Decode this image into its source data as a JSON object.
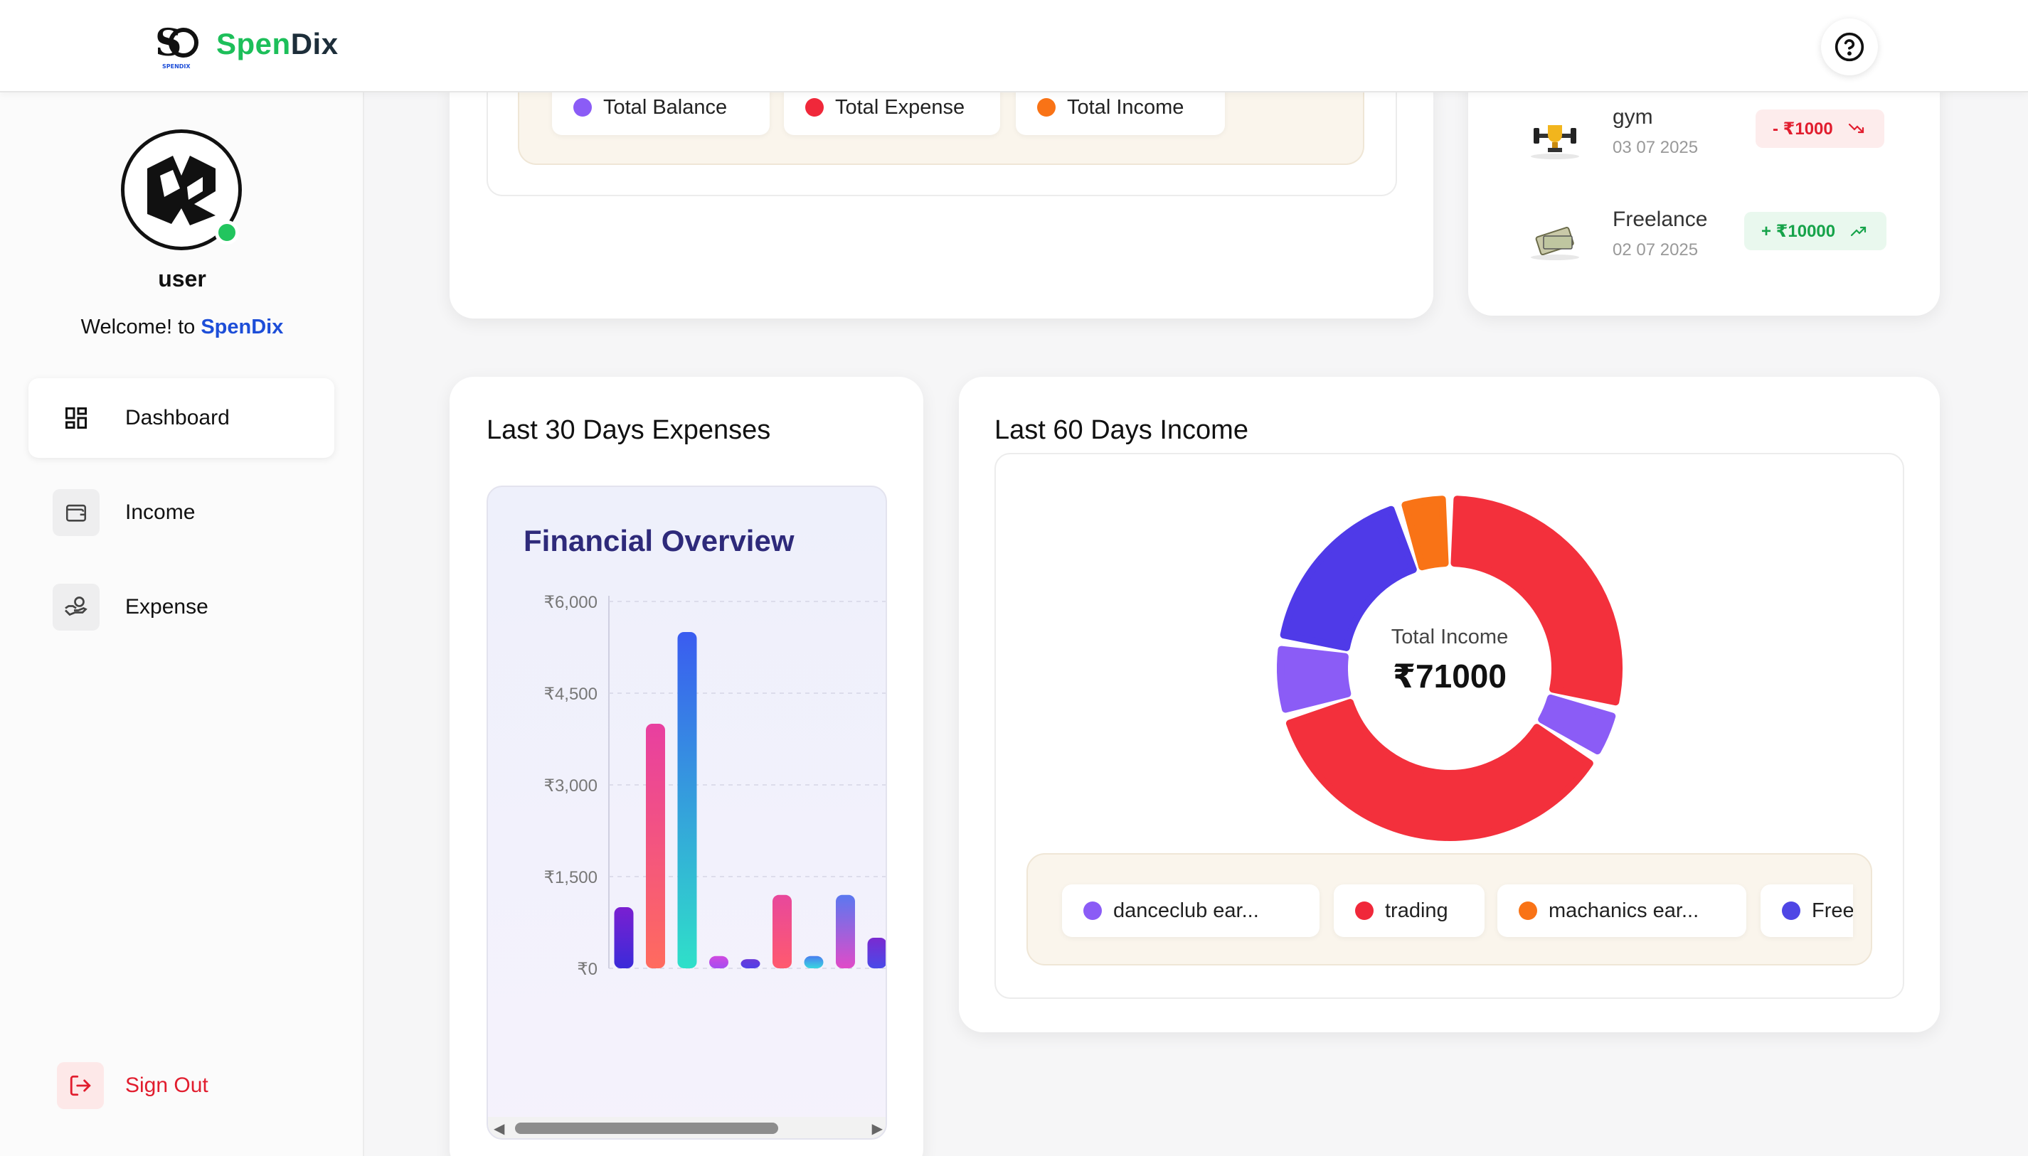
{
  "app": {
    "name_part1": "Spen",
    "name_part2": "Dix",
    "logo_caption": "SPENDIX"
  },
  "header": {
    "help_icon": "question-circle-icon"
  },
  "sidebar": {
    "username": "user",
    "welcome_prefix": "Welcome! to ",
    "welcome_brand": "SpenDix",
    "items": [
      {
        "label": "Dashboard",
        "icon": "dashboard-grid-icon",
        "active": true
      },
      {
        "label": "Income",
        "icon": "wallet-icon",
        "active": false
      },
      {
        "label": "Expense",
        "icon": "hand-coins-icon",
        "active": false
      }
    ],
    "signout_label": "Sign Out"
  },
  "overview_legend": [
    {
      "label": "Total Balance",
      "color": "#8b5cf6"
    },
    {
      "label": "Total Expense",
      "color": "#f0283a"
    },
    {
      "label": "Total Income",
      "color": "#f97316"
    }
  ],
  "transactions": [
    {
      "name": "gym",
      "date": "03 07 2025",
      "amount": "- ₹1000",
      "type": "expense",
      "icon": "gym-trophy-icon"
    },
    {
      "name": "Freelance",
      "date": "02 07 2025",
      "amount": "+ ₹10000",
      "type": "income",
      "icon": "money-icon"
    }
  ],
  "expenses_card": {
    "title": "Last 30 Days Expenses",
    "chart_title": "Financial Overview"
  },
  "income_card": {
    "title": "Last 60 Days Income",
    "center_label": "Total Income",
    "center_value": "₹71000",
    "legend": [
      {
        "label": "danceclub ear...",
        "color": "#8b5cf6"
      },
      {
        "label": "trading",
        "color": "#f0283a"
      },
      {
        "label": "machanics ear...",
        "color": "#f97316"
      },
      {
        "label": "Free",
        "color": "#4f46e5"
      }
    ]
  },
  "chart_data": [
    {
      "type": "bar",
      "title": "Financial Overview",
      "ylim": [
        0,
        6000
      ],
      "yticks": [
        "₹0",
        "₹1,500",
        "₹3,000",
        "₹4,500",
        "₹6,000"
      ],
      "values": [
        1000,
        4000,
        5500,
        200,
        150,
        1200,
        200,
        1200,
        500
      ],
      "grid": true
    },
    {
      "type": "pie",
      "title": "Last 60 Days Income",
      "total_label": "₹71000",
      "slices": [
        {
          "label": "trading",
          "value": 20500,
          "color": "#f3303c"
        },
        {
          "label": "danceclub ear...",
          "value": 3500,
          "color": "#8b5cf6"
        },
        {
          "label": "trading",
          "value": 26000,
          "color": "#f3303c"
        },
        {
          "label": "danceclub ear...",
          "value": 5000,
          "color": "#8b5cf6"
        },
        {
          "label": "Free",
          "value": 12500,
          "color": "#4f3ae8"
        },
        {
          "label": "machanics ear...",
          "value": 3500,
          "color": "#f97316"
        }
      ]
    }
  ]
}
